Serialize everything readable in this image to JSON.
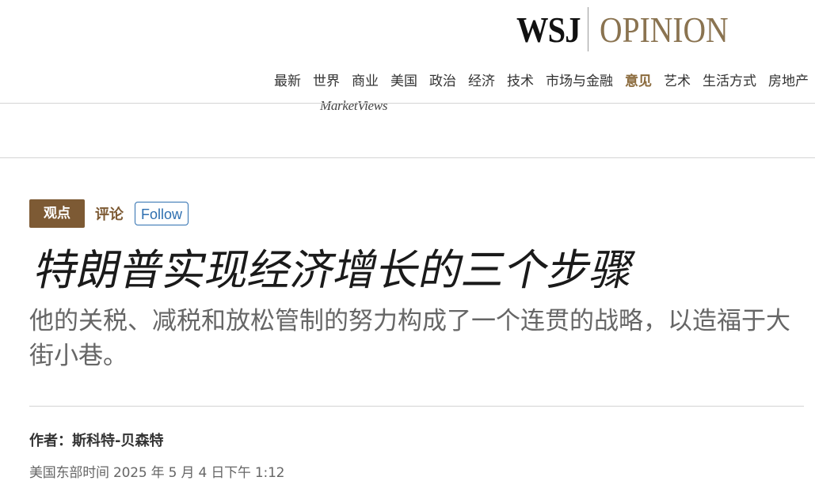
{
  "masthead": {
    "brand": "WSJ",
    "section": "OPINION"
  },
  "nav": {
    "items": [
      {
        "label": "最新"
      },
      {
        "label": "世界"
      },
      {
        "label": "商业"
      },
      {
        "label": "美国"
      },
      {
        "label": "政治"
      },
      {
        "label": "经济"
      },
      {
        "label": "技术"
      },
      {
        "label": "市场与金融"
      },
      {
        "label": "意见",
        "active": true
      },
      {
        "label": "艺术"
      },
      {
        "label": "生活方式"
      },
      {
        "label": "房地产"
      }
    ]
  },
  "ad": {
    "text": "MarketViews"
  },
  "article": {
    "flag": "观点",
    "category": "评论",
    "follow_label": "Follow",
    "headline": "特朗普实现经济增长的三个步骤",
    "dek": "他的关税、减税和放松管制的努力构成了一个连贯的战略，以造福于大街小巷。",
    "byline_prefix": "作者：",
    "author": "斯科特-贝森特",
    "timestamp": "美国东部时间 2025 年 5 月 4 日下午 1:12"
  },
  "colors": {
    "accent": "#8a7350",
    "flag_bg": "#7d5a34",
    "follow_blue": "#2e6fb0"
  }
}
